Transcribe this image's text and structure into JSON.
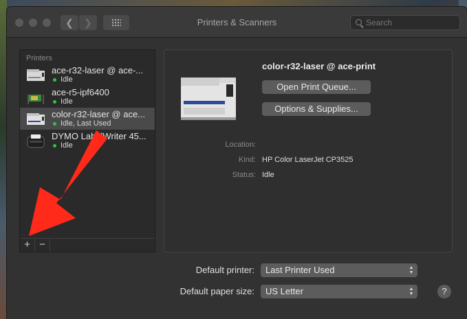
{
  "window": {
    "title": "Printers & Scanners",
    "search_placeholder": "Search"
  },
  "sidebar": {
    "header": "Printers",
    "printers": [
      {
        "name": "ace-r32-laser @ ace-...",
        "status": "Idle",
        "status_color": "#2bc93f"
      },
      {
        "name": "ace-r5-ipf6400",
        "status": "Idle",
        "status_color": "#2bc93f"
      },
      {
        "name": "color-r32-laser @ ace...",
        "status": "Idle, Last Used",
        "status_color": "#2bc93f"
      },
      {
        "name": "DYMO LabelWriter 45...",
        "status": "Idle",
        "status_color": "#2bc93f"
      }
    ],
    "add_label": "+",
    "remove_label": "−"
  },
  "detail": {
    "printer_name": "color-r32-laser @ ace-print",
    "open_queue_label": "Open Print Queue...",
    "options_label": "Options & Supplies...",
    "location_label": "Location:",
    "location_value": "",
    "kind_label": "Kind:",
    "kind_value": "HP Color LaserJet CP3525",
    "status_label": "Status:",
    "status_value": "Idle"
  },
  "defaults": {
    "default_printer_label": "Default printer:",
    "default_printer_value": "Last Printer Used",
    "paper_size_label": "Default paper size:",
    "paper_size_value": "US Letter"
  },
  "help_label": "?",
  "colors": {
    "annotation_arrow": "#ff2a1a",
    "idle_dot": "#2bc93f"
  }
}
